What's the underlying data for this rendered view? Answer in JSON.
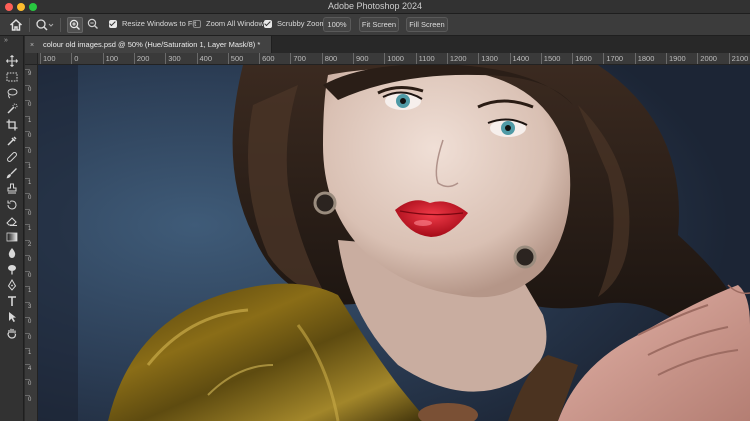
{
  "window": {
    "title": "Adobe Photoshop 2024"
  },
  "options_bar": {
    "resize_windows": {
      "label": "Resize Windows to Fit",
      "checked": true
    },
    "zoom_all_windows": {
      "label": "Zoom All Windows",
      "checked": false
    },
    "scrubby_zoom": {
      "label": "Scrubby Zoom",
      "checked": true
    },
    "zoom_percent": "100%",
    "fit_screen": "Fit Screen",
    "fill_screen": "Fill Screen"
  },
  "document_tab": {
    "close_glyph": "×",
    "title": "colour old images.psd @ 50% (Hue/Saturation 1, Layer Mask/8) *"
  },
  "toolbar": {
    "collapse_glyph": "»",
    "tools": [
      "move-tool",
      "marquee-tool",
      "lasso-tool",
      "quick-selection-tool",
      "crop-tool",
      "eyedropper-tool",
      "spot-healing-tool",
      "brush-tool",
      "clone-stamp-tool",
      "history-brush-tool",
      "eraser-tool",
      "gradient-tool",
      "blur-tool",
      "dodge-tool",
      "pen-tool",
      "type-tool",
      "path-selection-tool",
      "hand-tool"
    ]
  },
  "ruler": {
    "horizontal_labels": [
      "100",
      "0",
      "100",
      "200",
      "300",
      "400",
      "500",
      "600",
      "700",
      "800",
      "900",
      "1000",
      "1100",
      "1200",
      "1300",
      "1400",
      "1500",
      "1600",
      "1700",
      "1800",
      "1900",
      "2000",
      "2100"
    ],
    "vertical_labels": [
      "9",
      "0",
      "0",
      "1",
      "0",
      "0",
      "1",
      "1",
      "0",
      "0",
      "1",
      "2",
      "0",
      "0",
      "1",
      "3",
      "0",
      "0",
      "1",
      "4",
      "0",
      "0"
    ]
  },
  "colors": {
    "app_bg": "#2b2b2b",
    "panel": "#3c3c3c",
    "lip_red": "#c8101f"
  }
}
